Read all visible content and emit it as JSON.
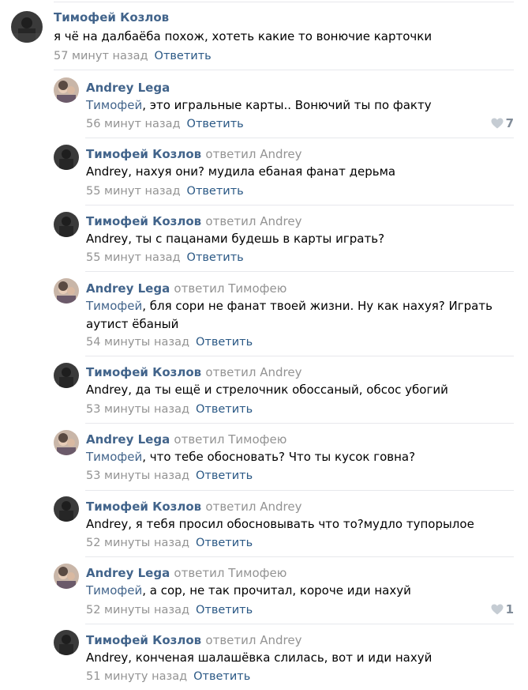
{
  "comments": [
    {
      "author": "Тимофей Козлов",
      "replied": "",
      "mention": "",
      "text": "я чё на далбаёба похож, хотеть какие то вонючие карточки",
      "time": "57 минут назад",
      "reply": "Ответить",
      "likes": "",
      "avatar": "kozlov"
    },
    {
      "author": "Andrey Lega",
      "replied": "",
      "mention": "Тимофей",
      "text": ", это игральные карты.. Вонючий ты по факту",
      "time": "56 минут назад",
      "reply": "Ответить",
      "likes": "7",
      "avatar": "lega"
    },
    {
      "author": "Тимофей Козлов",
      "replied": "ответил Andrey",
      "mention": "",
      "text": "Andrey, нахуя они? мудила ебаная фанат дерьма",
      "time": "55 минут назад",
      "reply": "Ответить",
      "likes": "",
      "avatar": "kozlov"
    },
    {
      "author": "Тимофей Козлов",
      "replied": "ответил Andrey",
      "mention": "",
      "text": "Andrey, ты с пацанами будешь в карты играть?",
      "time": "55 минут назад",
      "reply": "Ответить",
      "likes": "",
      "avatar": "kozlov"
    },
    {
      "author": "Andrey Lega",
      "replied": "ответил Тимофею",
      "mention": "Тимофей",
      "text": ", бля сори не фанат твоей жизни. Ну как нахуя? Играть аутист ёбаный",
      "time": "54 минуты назад",
      "reply": "Ответить",
      "likes": "",
      "avatar": "lega"
    },
    {
      "author": "Тимофей Козлов",
      "replied": "ответил Andrey",
      "mention": "",
      "text": "Andrey, да ты ещё и стрелочник обоссаный, обсос убогий",
      "time": "53 минуты назад",
      "reply": "Ответить",
      "likes": "",
      "avatar": "kozlov"
    },
    {
      "author": "Andrey Lega",
      "replied": "ответил Тимофею",
      "mention": "Тимофей",
      "text": ", что тебе обосновать? Что ты кусок говна?",
      "time": "53 минуты назад",
      "reply": "Ответить",
      "likes": "",
      "avatar": "lega"
    },
    {
      "author": "Тимофей Козлов",
      "replied": "ответил Andrey",
      "mention": "",
      "text": "Andrey, я тебя просил обосновывать что то?мудло тупорылое",
      "time": "52 минуты назад",
      "reply": "Ответить",
      "likes": "",
      "avatar": "kozlov"
    },
    {
      "author": "Andrey Lega",
      "replied": "ответил Тимофею",
      "mention": "Тимофей",
      "text": ", а сор, не так прочитал, короче иди нахуй",
      "time": "52 минуты назад",
      "reply": "Ответить",
      "likes": "1",
      "avatar": "lega"
    },
    {
      "author": "Тимофей Козлов",
      "replied": "ответил Andrey",
      "mention": "",
      "text": "Andrey, конченая шалашёвка слилась, вот и иди нахуй",
      "time": "51 минуту назад",
      "reply": "Ответить",
      "likes": "",
      "avatar": "kozlov"
    }
  ],
  "colors": {
    "link": "#42648b",
    "reply": "#2a5885",
    "muted": "#939393",
    "separator": "#e7e8ec"
  }
}
